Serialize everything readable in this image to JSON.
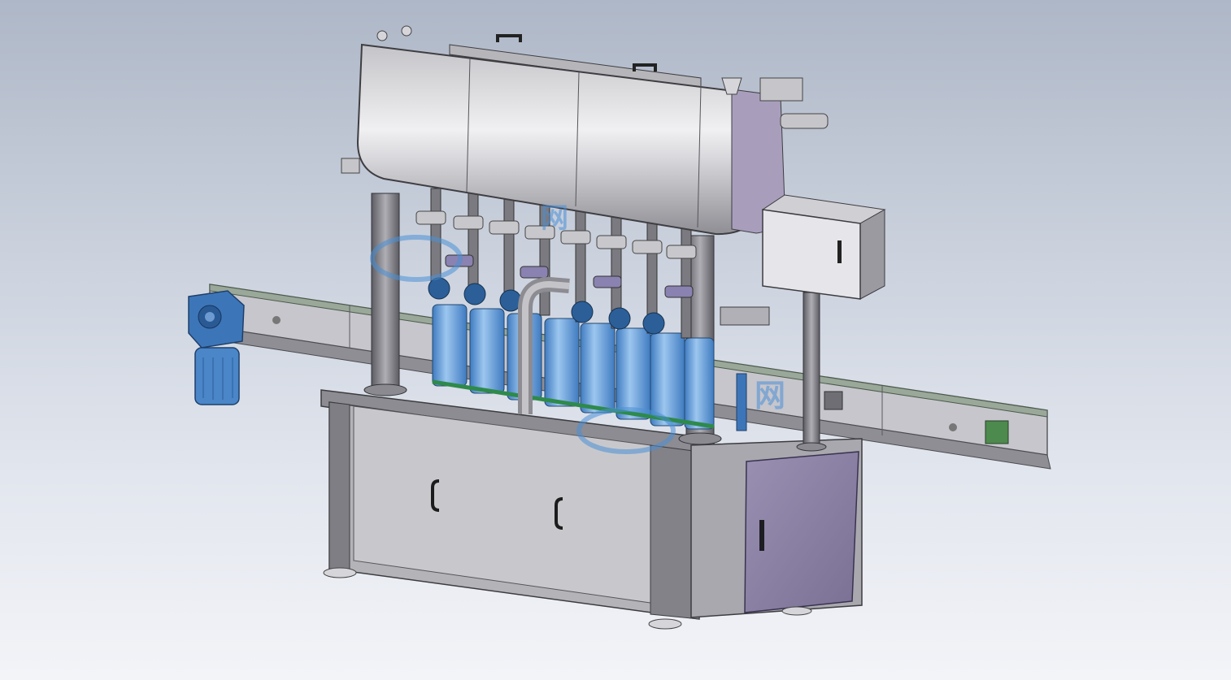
{
  "scene": {
    "subject": "liquid-filling-machine-cad-model",
    "background_colors": [
      "#aeb7c7",
      "#c9d0dc",
      "#f3f4f8"
    ],
    "colors": {
      "steel": "#9a9a9e",
      "steel_dark": "#6e6e74",
      "cabinet_purple": "#8a7fa0",
      "cylinder_blue": "#5a9ad6",
      "motor_blue": "#3c76b8",
      "watermark_blue": "#4b8fd6"
    },
    "filling_heads": 8
  },
  "watermark": {
    "primary_glyph": "网",
    "secondary_glyph": "网"
  }
}
